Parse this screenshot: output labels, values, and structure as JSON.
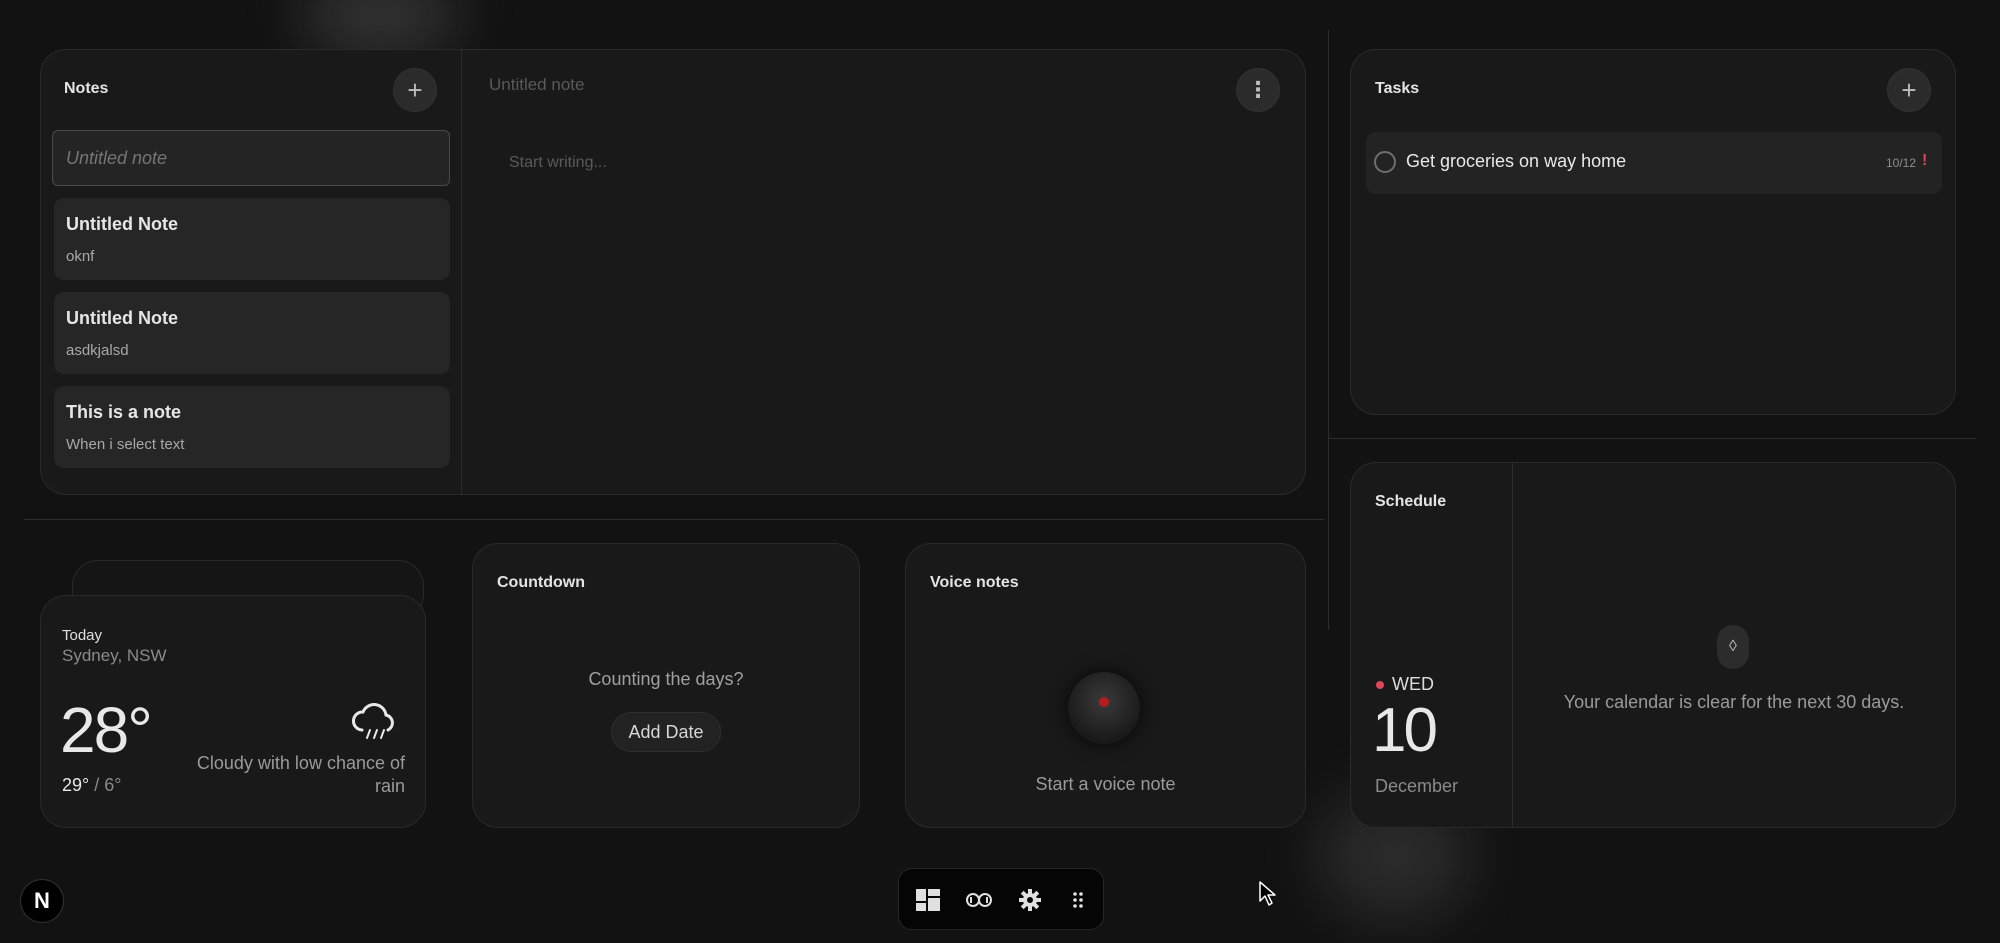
{
  "notes": {
    "title": "Notes",
    "add_glyph": "+",
    "search_placeholder": "Untitled note",
    "editor_title_placeholder": "Untitled note",
    "editor_body_placeholder": "Start writing...",
    "menu_glyph": "⋮",
    "items": [
      {
        "title": "Untitled Note",
        "preview": "oknf"
      },
      {
        "title": "Untitled Note",
        "preview": "asdkjalsd"
      },
      {
        "title": "This is a note",
        "preview": "When i select text"
      }
    ]
  },
  "tasks": {
    "title": "Tasks",
    "add_glyph": "+",
    "items": [
      {
        "label": "Get groceries on way home",
        "date": "10/12",
        "priority": "!"
      }
    ]
  },
  "schedule": {
    "title": "Schedule",
    "weekday": "WED",
    "day": "10",
    "month": "December",
    "empty_text": "Your calendar is clear for the next 30 days.",
    "empty_icon": "◊"
  },
  "weather": {
    "label": "Today",
    "location": "Sydney, NSW",
    "temp": "28°",
    "high": "29°",
    "separator": "/",
    "low": "6°",
    "description": "Cloudy with low chance of rain",
    "icon": "cloud-rain-icon"
  },
  "countdown": {
    "title": "Countdown",
    "prompt": "Counting the days?",
    "button": "Add Date"
  },
  "voice": {
    "title": "Voice notes",
    "prompt": "Start a voice note"
  },
  "app": {
    "logo_letter": "N"
  },
  "colors": {
    "background": "#121212",
    "panel": "#191919",
    "accent_red": "#e0455a",
    "record_red": "#b51d1d"
  }
}
